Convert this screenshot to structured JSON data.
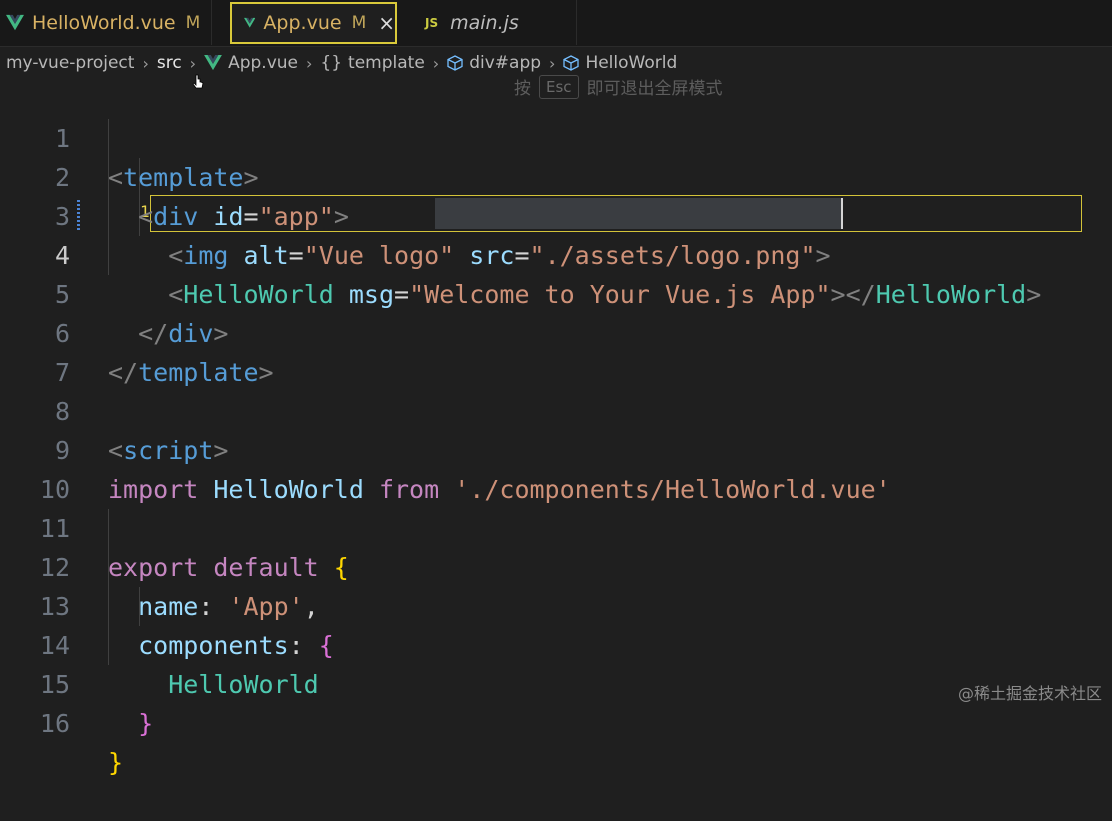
{
  "tabs": [
    {
      "label": "HelloWorld.vue",
      "status": "M",
      "icon": "vue-icon"
    },
    {
      "label": "App.vue",
      "status": "M",
      "icon": "vue-icon",
      "close": "×"
    },
    {
      "label": "main.js",
      "icon": "js-icon",
      "icon_text": "JS"
    }
  ],
  "breadcrumb": {
    "items": [
      "my-vue-project",
      "src",
      "App.vue",
      "template",
      "div#app",
      "HelloWorld"
    ],
    "template_icon": "{}"
  },
  "esc_hint": {
    "prefix": "按",
    "key": "Esc",
    "suffix": "即可退出全屏模式"
  },
  "gutter": {
    "line4_badge": "1"
  },
  "lines": [
    {
      "num": "1"
    },
    {
      "num": "2"
    },
    {
      "num": "3"
    },
    {
      "num": "4"
    },
    {
      "num": "5"
    },
    {
      "num": "6"
    },
    {
      "num": "7"
    },
    {
      "num": "8"
    },
    {
      "num": "9"
    },
    {
      "num": "10"
    },
    {
      "num": "11"
    },
    {
      "num": "12"
    },
    {
      "num": "13"
    },
    {
      "num": "14"
    },
    {
      "num": "15"
    },
    {
      "num": "16"
    }
  ],
  "code": {
    "l1": {
      "open": "<",
      "tag": "template",
      "close": ">"
    },
    "l2": {
      "open": "<",
      "tag": "div",
      "attr": "id",
      "eq": "=",
      "val": "\"app\"",
      "close": ">"
    },
    "l3": {
      "open": "<",
      "tag": "img",
      "attr1": "alt",
      "eq": "=",
      "val1": "\"Vue logo\"",
      "attr2": "src",
      "val2": "\"./assets/logo.png\"",
      "close": ">"
    },
    "l4": {
      "open": "<",
      "tag": "HelloWorld",
      "attr": "msg",
      "eq": "=",
      "q1": "\"",
      "val": "Welcome to Your Vue.js App",
      "q2": "\"",
      "close": ">",
      "endopen": "</",
      "endtag": "HelloWorld",
      "endclose": ">"
    },
    "l5": {
      "open": "</",
      "tag": "div",
      "close": ">"
    },
    "l6": {
      "open": "</",
      "tag": "template",
      "close": ">"
    },
    "l8": {
      "open": "<",
      "tag": "script",
      "close": ">"
    },
    "l9": {
      "kw1": "import",
      "id": "HelloWorld",
      "kw2": "from",
      "str": "'./components/HelloWorld.vue'"
    },
    "l11": {
      "kw1": "export",
      "kw2": "default",
      "brace": "{"
    },
    "l12": {
      "key": "name",
      "colon": ":",
      "str": "'App'",
      "comma": ","
    },
    "l13": {
      "key": "components",
      "colon": ":",
      "brace": "{"
    },
    "l14": {
      "id": "HelloWorld"
    },
    "l15": {
      "brace": "}"
    },
    "l16": {
      "brace": "}"
    }
  },
  "watermark": "@稀土掘金技术社区",
  "colors": {
    "accent_border": "#d3c339",
    "tab_label": "#d8b264",
    "background": "#1f1f1f"
  }
}
